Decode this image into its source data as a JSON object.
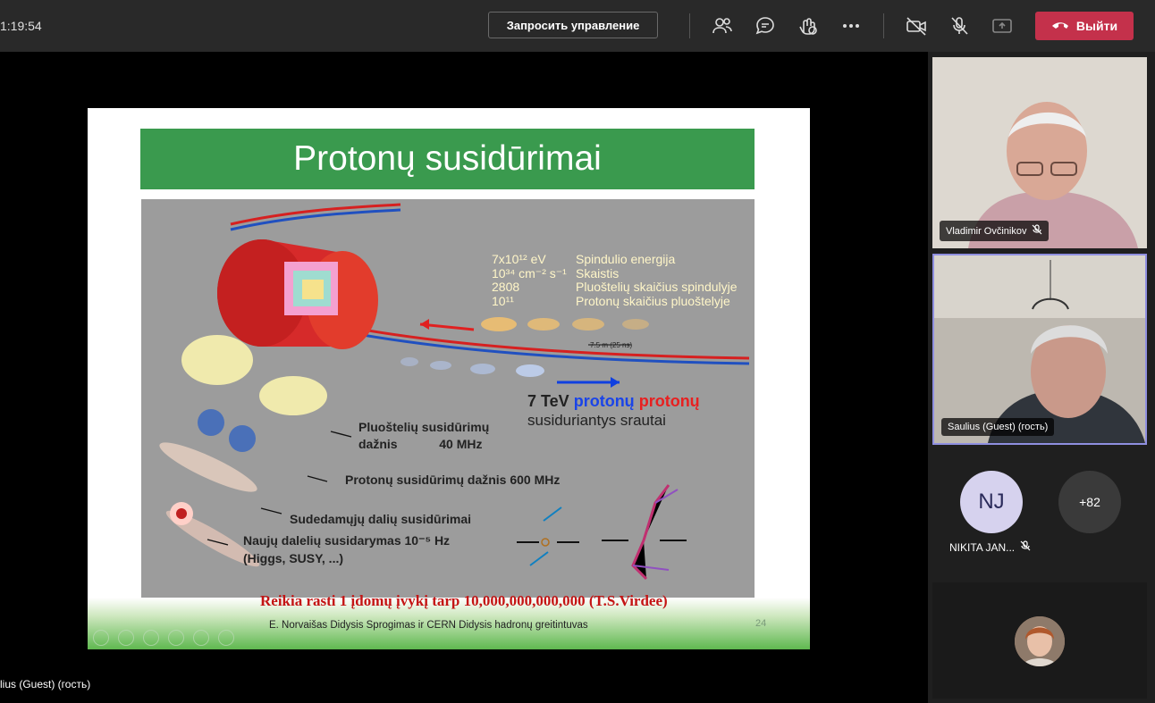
{
  "topbar": {
    "timer": "1:19:54",
    "request_control": "Запросить управление",
    "leave": "Выйти",
    "icons": [
      "people-icon",
      "chat-icon",
      "reactions-icon",
      "more-icon",
      "camera-off-icon",
      "mic-off-icon",
      "share-icon"
    ]
  },
  "slide": {
    "title": "Protonų susidūrimai",
    "specs": [
      {
        "value": "7x10¹² eV",
        "label": "Spindulio energija"
      },
      {
        "value": "10³⁴ cm⁻² s⁻¹",
        "label": "Skaistis"
      },
      {
        "value": "2808",
        "label": "Pluoštelių skaičius spindulyje"
      },
      {
        "value": "10¹¹",
        "label": "Protonų skaičius pluoštelyje"
      }
    ],
    "spacing": "7.5 m  (25 ns)",
    "beam_energy": "7 TeV",
    "proton_blue": "protonų",
    "proton_red": "protonų",
    "beams_caption": "susiduriantys srautai",
    "bunch_freq_1": "Pluoštelių susidūrimų",
    "bunch_freq_2": "dažnis            40 MHz",
    "proton_freq": "Protonų susidūrimų dažnis 600 MHz",
    "parts": "Sudedamųjų dalių susidūrimai",
    "new_particles_1": "Naujų dalelių susidarymas  10⁻⁵ Hz",
    "new_particles_2": "(Higgs, SUSY, ...)",
    "banner": "Reikia rasti 1 įdomų įvykį  tarp 10,000,000,000,000 (T.S.Virdee)",
    "footer": "E. Norvaišas    Didysis Sprogimas ir CERN Didysis hadronų greitintuvas",
    "page": "24"
  },
  "presenter_label": "lius (Guest) (гость)",
  "participants": [
    {
      "name": "Vladimir Ovčinikov"
    },
    {
      "name": "Saulius (Guest) (гость)"
    },
    {
      "initials": "NJ",
      "name": "NIKITA JAN..."
    },
    {
      "overflow": "+82"
    }
  ],
  "colors": {
    "accent_red": "#c4314b",
    "slide_green": "#3a9a4e",
    "active_border": "#8f8fe0"
  }
}
